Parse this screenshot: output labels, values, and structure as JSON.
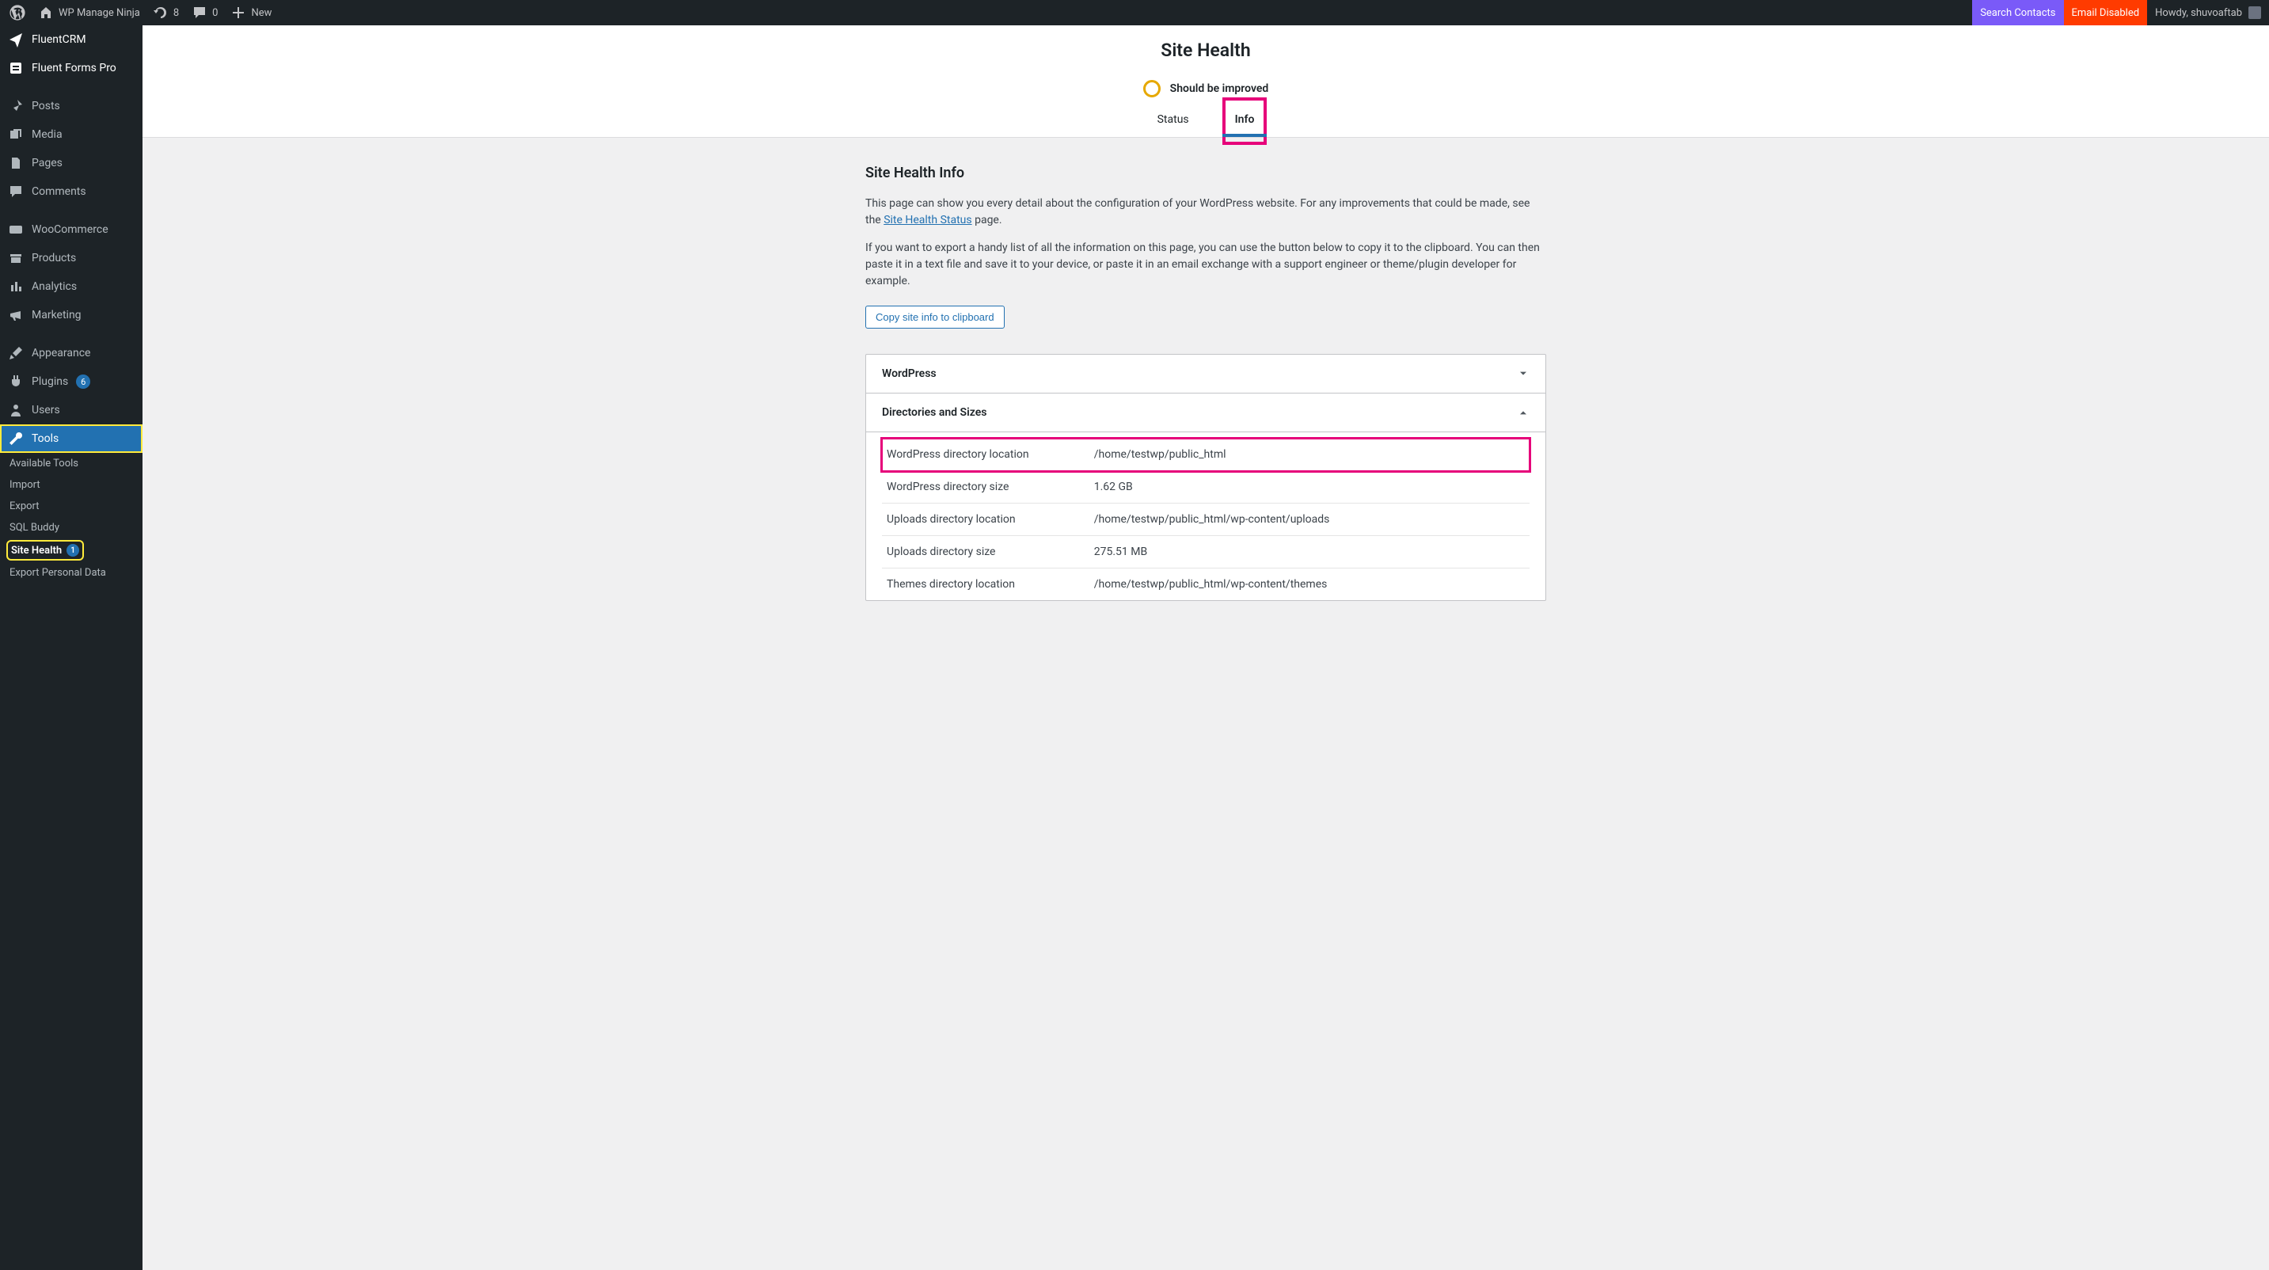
{
  "adminbar": {
    "site_name": "WP Manage Ninja",
    "updates_count": "8",
    "comments_count": "0",
    "new_label": "New",
    "search_contacts": "Search Contacts",
    "email_disabled": "Email Disabled",
    "howdy": "Howdy, shuvoaftab"
  },
  "menu": {
    "items": [
      {
        "id": "fluentcrm",
        "label": "FluentCRM",
        "icon": "paper-plane",
        "top": true
      },
      {
        "id": "fluentforms",
        "label": "Fluent Forms Pro",
        "icon": "form",
        "top": true
      },
      {
        "id": "sep"
      },
      {
        "id": "posts",
        "label": "Posts",
        "icon": "pin"
      },
      {
        "id": "media",
        "label": "Media",
        "icon": "media"
      },
      {
        "id": "pages",
        "label": "Pages",
        "icon": "pages"
      },
      {
        "id": "comments",
        "label": "Comments",
        "icon": "comment"
      },
      {
        "id": "sep"
      },
      {
        "id": "woocommerce",
        "label": "WooCommerce",
        "icon": "woo"
      },
      {
        "id": "products",
        "label": "Products",
        "icon": "archive"
      },
      {
        "id": "analytics",
        "label": "Analytics",
        "icon": "chart"
      },
      {
        "id": "marketing",
        "label": "Marketing",
        "icon": "megaphone"
      },
      {
        "id": "sep"
      },
      {
        "id": "appearance",
        "label": "Appearance",
        "icon": "brush"
      },
      {
        "id": "plugins",
        "label": "Plugins",
        "icon": "plug",
        "count": "6"
      },
      {
        "id": "users",
        "label": "Users",
        "icon": "user"
      },
      {
        "id": "tools",
        "label": "Tools",
        "icon": "wrench",
        "current": true,
        "highlight": true
      }
    ],
    "tools_submenu": [
      {
        "id": "available-tools",
        "label": "Available Tools"
      },
      {
        "id": "import",
        "label": "Import"
      },
      {
        "id": "export",
        "label": "Export"
      },
      {
        "id": "sql-buddy",
        "label": "SQL Buddy"
      },
      {
        "id": "site-health",
        "label": "Site Health",
        "count": "1",
        "current": true,
        "highlight": true
      },
      {
        "id": "export-personal",
        "label": "Export Personal Data"
      }
    ]
  },
  "header": {
    "title": "Site Health",
    "progress_label": "Should be improved",
    "tabs": {
      "status": "Status",
      "info": "Info"
    }
  },
  "body": {
    "heading": "Site Health Info",
    "p1a": "This page can show you every detail about the configuration of your WordPress website. For any improvements that could be made, see the ",
    "p1_link": "Site Health Status",
    "p1b": " page.",
    "p2": "If you want to export a handy list of all the information on this page, you can use the button below to copy it to the clipboard. You can then paste it in a text file and save it to your device, or paste it in an email exchange with a support engineer or theme/plugin developer for example.",
    "copy_btn": "Copy site info to clipboard",
    "sections": {
      "wordpress": {
        "title": "WordPress"
      },
      "dirs": {
        "title": "Directories and Sizes",
        "rows": [
          {
            "label": "WordPress directory location",
            "value": "/home/testwp/public_html",
            "highlight": true
          },
          {
            "label": "WordPress directory size",
            "value": "1.62 GB"
          },
          {
            "label": "Uploads directory location",
            "value": "/home/testwp/public_html/wp-content/uploads"
          },
          {
            "label": "Uploads directory size",
            "value": "275.51 MB"
          },
          {
            "label": "Themes directory location",
            "value": "/home/testwp/public_html/wp-content/themes"
          }
        ]
      }
    }
  }
}
